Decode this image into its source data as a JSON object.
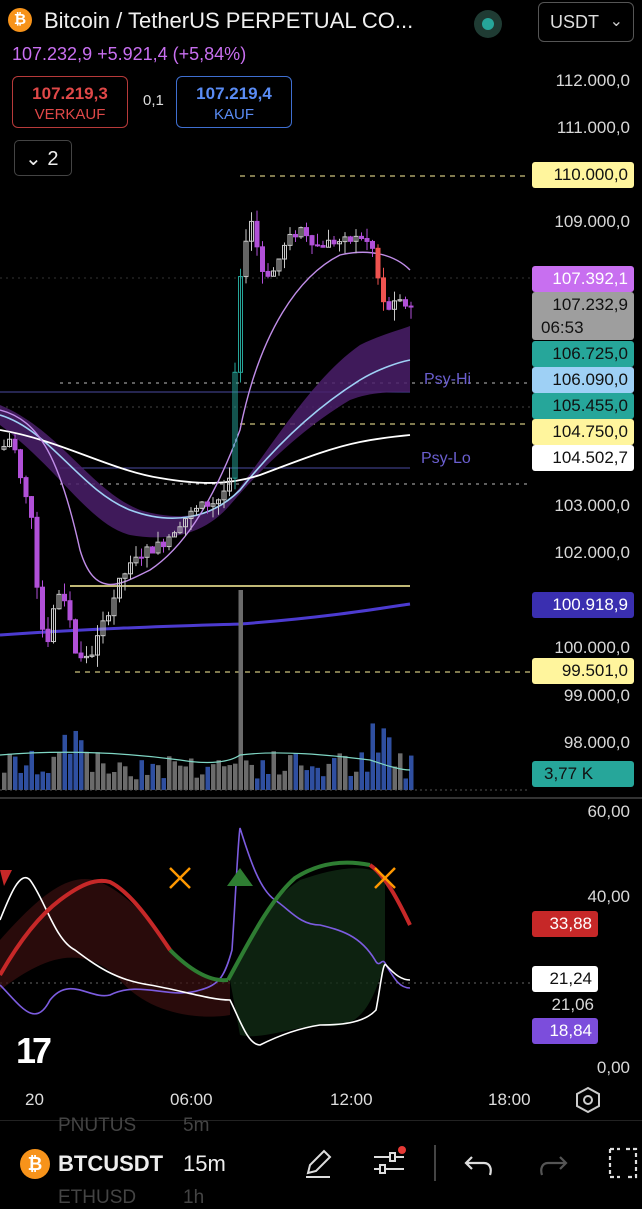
{
  "header": {
    "coin_symbol": "₿",
    "title": "Bitcoin / TetherUS PERPETUAL CO...",
    "currency": "USDT",
    "price_change": "107.232,9  +5.921,4 (+5,84%)"
  },
  "trade": {
    "sell_price": "107.219,3",
    "sell_label": "VERKAUF",
    "spread": "0,1",
    "buy_price": "107.219,4",
    "buy_label": "KAUF"
  },
  "collapse": {
    "count": "2"
  },
  "price_axis": [
    "112.000,0",
    "111.000,0",
    "109.000,0",
    "103.000,0",
    "102.000,0",
    "100.000,0",
    "99.000,0",
    "98.000,0"
  ],
  "price_tags": {
    "t110": "110.000,0",
    "t107_392": "107.392,1",
    "t_last": "107.232,9",
    "t_countdown": "06:53",
    "t106_725": "106.725,0",
    "t106_090": "106.090,0",
    "t105_455": "105.455,0",
    "t104_750": "104.750,0",
    "t104_502": "104.502,7",
    "t100_918": "100.918,9",
    "t99_501": "99.501,0",
    "volume": "3,77 K"
  },
  "chart_labels": {
    "psy_hi": "Psy-Hi",
    "psy_lo": "Psy-Lo"
  },
  "osc_axis": [
    "60,00",
    "40,00",
    "0,00"
  ],
  "osc_tags": {
    "red": "33,88",
    "white": "21,24",
    "plain": "21,06",
    "purple": "18,84"
  },
  "time_axis": [
    "20",
    "06:00",
    "12:00",
    "18:00"
  ],
  "logo": "17",
  "bottom": {
    "symbol": "BTCUSDT",
    "interval": "15m",
    "ghost_above_symbol": "PNUTUS",
    "ghost_above_interval": "5m",
    "ghost_below_symbol": "ETHUSD",
    "ghost_below_interval": "1h"
  },
  "colors": {
    "up": "#c8c8c8",
    "down": "#b150d8",
    "bull_marker": "#26a69a",
    "bear_marker": "#ef5350",
    "accent_purple": "#c86ff0",
    "yellow_tag": "#fff59d"
  }
}
